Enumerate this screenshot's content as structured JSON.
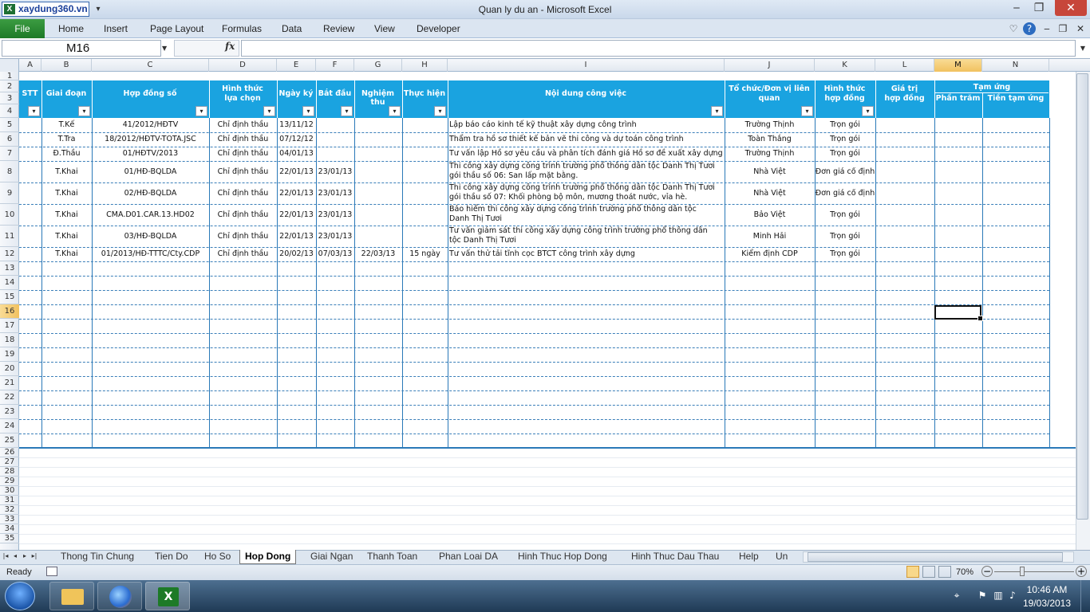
{
  "window": {
    "title": "Quan ly du an  -  Microsoft Excel",
    "logo_text": "xaydung360.vn",
    "logo_letter": "X",
    "controls": {
      "minimize": "‒",
      "restore": "❐",
      "close": "✕"
    }
  },
  "ribbon": {
    "file_label": "File",
    "tabs": [
      "Home",
      "Insert",
      "Page Layout",
      "Formulas",
      "Data",
      "Review",
      "View",
      "Developer"
    ]
  },
  "formula_bar": {
    "name_box": "M16",
    "fx_label": "fx",
    "formula": ""
  },
  "columns": [
    "A",
    "B",
    "C",
    "D",
    "E",
    "F",
    "G",
    "H",
    "I",
    "J",
    "K",
    "L",
    "M",
    "N"
  ],
  "selected_column": "M",
  "rows": [
    "1",
    "2",
    "3",
    "4",
    "5",
    "6",
    "7",
    "8",
    "9",
    "10",
    "11",
    "12",
    "13",
    "14",
    "15",
    "16",
    "17",
    "18",
    "19",
    "20",
    "21",
    "22",
    "23",
    "24",
    "25",
    "26",
    "27",
    "28",
    "29",
    "30",
    "31",
    "32",
    "33",
    "34",
    "35"
  ],
  "selected_row": "16",
  "table_headers": {
    "stt": "STT",
    "giai_doan": "Giai đoạn",
    "hop_dong_so": "Hợp đồng số",
    "hinh_thuc_lua_chon_1": "Hình thức",
    "hinh_thuc_lua_chon_2": "lựa chọn",
    "ngay_ky": "Ngày ký",
    "bat_dau": "Bắt đầu",
    "nghiem_thu": "Nghiệm thu",
    "thuc_hien": "Thực hiện",
    "noi_dung": "Nội dung công việc",
    "to_chuc_1": "Tổ chức/Đơn vị liên",
    "to_chuc_2": "quan",
    "hinh_thuc_hop_dong_1": "Hình thức",
    "hinh_thuc_hop_dong_2": "hợp đồng",
    "gia_tri_1": "Giá trị",
    "gia_tri_2": "hợp đồng",
    "tam_ung": "Tạm ứng",
    "phan_tram": "Phần trăm",
    "tien_tam_ung": "Tiền tạm ứng",
    "filter_arrow": "▾"
  },
  "data_rows": [
    {
      "giai_doan": "T.Kế",
      "hop_dong_so": "41/2012/HĐTV",
      "hinh_thuc": "Chỉ định thầu",
      "ngay_ky": "13/11/12",
      "bat_dau": "",
      "nghiem_thu": "",
      "thuc_hien": "",
      "noi_dung": "Lập báo cáo kinh tế kỹ thuật xây dựng công trình",
      "to_chuc": "Trường Thịnh",
      "hinh_thuc_hd": "Trọn gói"
    },
    {
      "giai_doan": "T.Tra",
      "hop_dong_so": "18/2012/HĐTV-TOTA.JSC",
      "hinh_thuc": "Chỉ định thầu",
      "ngay_ky": "07/12/12",
      "bat_dau": "",
      "nghiem_thu": "",
      "thuc_hien": "",
      "noi_dung": "Thẩm tra hồ sơ thiết kế bản vẽ thi công và dự toán công trình",
      "to_chuc": "Toàn Thắng",
      "hinh_thuc_hd": "Trọn gói"
    },
    {
      "giai_doan": "Đ.Thầu",
      "hop_dong_so": "01/HĐTV/2013",
      "hinh_thuc": "Chỉ định thầu",
      "ngay_ky": "04/01/13",
      "bat_dau": "",
      "nghiem_thu": "",
      "thuc_hien": "",
      "noi_dung": "Tư vấn lập Hồ sơ yêu cầu và phân tích đánh giá Hồ sơ đề xuất xây dựng",
      "to_chuc": "Trường Thịnh",
      "hinh_thuc_hd": "Trọn gói"
    },
    {
      "giai_doan": "T.Khai",
      "hop_dong_so": "01/HĐ-BQLDA",
      "hinh_thuc": "Chỉ định thầu",
      "ngay_ky": "22/01/13",
      "bat_dau": "23/01/13",
      "nghiem_thu": "",
      "thuc_hien": "",
      "noi_dung": "Thi công xây dựng công trình trường phổ thông dân tộc Danh Thị Tươi gói thầu số 06: San lấp mặt bằng.",
      "to_chuc": "Nhà Việt",
      "hinh_thuc_hd": "Đơn giá cố định"
    },
    {
      "giai_doan": "T.Khai",
      "hop_dong_so": "02/HĐ-BQLDA",
      "hinh_thuc": "Chỉ định thầu",
      "ngay_ky": "22/01/13",
      "bat_dau": "23/01/13",
      "nghiem_thu": "",
      "thuc_hien": "",
      "noi_dung": "Thi công xây dựng công trình trường phổ thông dân tộc Danh Thị Tươi gói thầu số 07: Khối phòng bộ môn, mương thoát nước, vỉa hè.",
      "to_chuc": "Nhà Việt",
      "hinh_thuc_hd": "Đơn giá cố định"
    },
    {
      "giai_doan": "T.Khai",
      "hop_dong_so": "CMA.D01.CAR.13.HD02",
      "hinh_thuc": "Chỉ định thầu",
      "ngay_ky": "22/01/13",
      "bat_dau": "23/01/13",
      "nghiem_thu": "",
      "thuc_hien": "",
      "noi_dung": "Bảo hiểm thi công xây dựng công trình trường phổ thông dân tộc Danh Thị Tươi",
      "to_chuc": "Bảo Việt",
      "hinh_thuc_hd": "Trọn gói"
    },
    {
      "giai_doan": "T.Khai",
      "hop_dong_so": "03/HĐ-BQLDA",
      "hinh_thuc": "Chỉ định thầu",
      "ngay_ky": "22/01/13",
      "bat_dau": "23/01/13",
      "nghiem_thu": "",
      "thuc_hien": "",
      "noi_dung": "Tư vấn giám sát thi công xây dựng công trình trường phổ thông dân tộc Danh Thị Tươi",
      "to_chuc": "Minh Hải",
      "hinh_thuc_hd": "Trọn gói"
    },
    {
      "giai_doan": "T.Khai",
      "hop_dong_so": "01/2013/HĐ-TTTC/Cty.CDP",
      "hinh_thuc": "Chỉ định thầu",
      "ngay_ky": "20/02/13",
      "bat_dau": "07/03/13",
      "nghiem_thu": "22/03/13",
      "thuc_hien": "15 ngày",
      "noi_dung": "Tư vấn thử tải tĩnh cọc BTCT công trình xây dựng",
      "to_chuc": "Kiểm định CDP",
      "hinh_thuc_hd": "Trọn gói"
    }
  ],
  "sheet_tabs": [
    "Thong Tin Chung",
    "Tien Do",
    "Ho So",
    "Hop Dong",
    "Giai Ngan",
    "Thanh Toan",
    "Phan Loai DA",
    "Hinh Thuc Hop Dong",
    "Hinh Thuc Dau Thau",
    "Help",
    "Un"
  ],
  "active_sheet": "Hop Dong",
  "status": {
    "ready": "Ready",
    "zoom": "70%"
  },
  "taskbar": {
    "time": "10:46 AM",
    "date": "19/03/2013"
  }
}
